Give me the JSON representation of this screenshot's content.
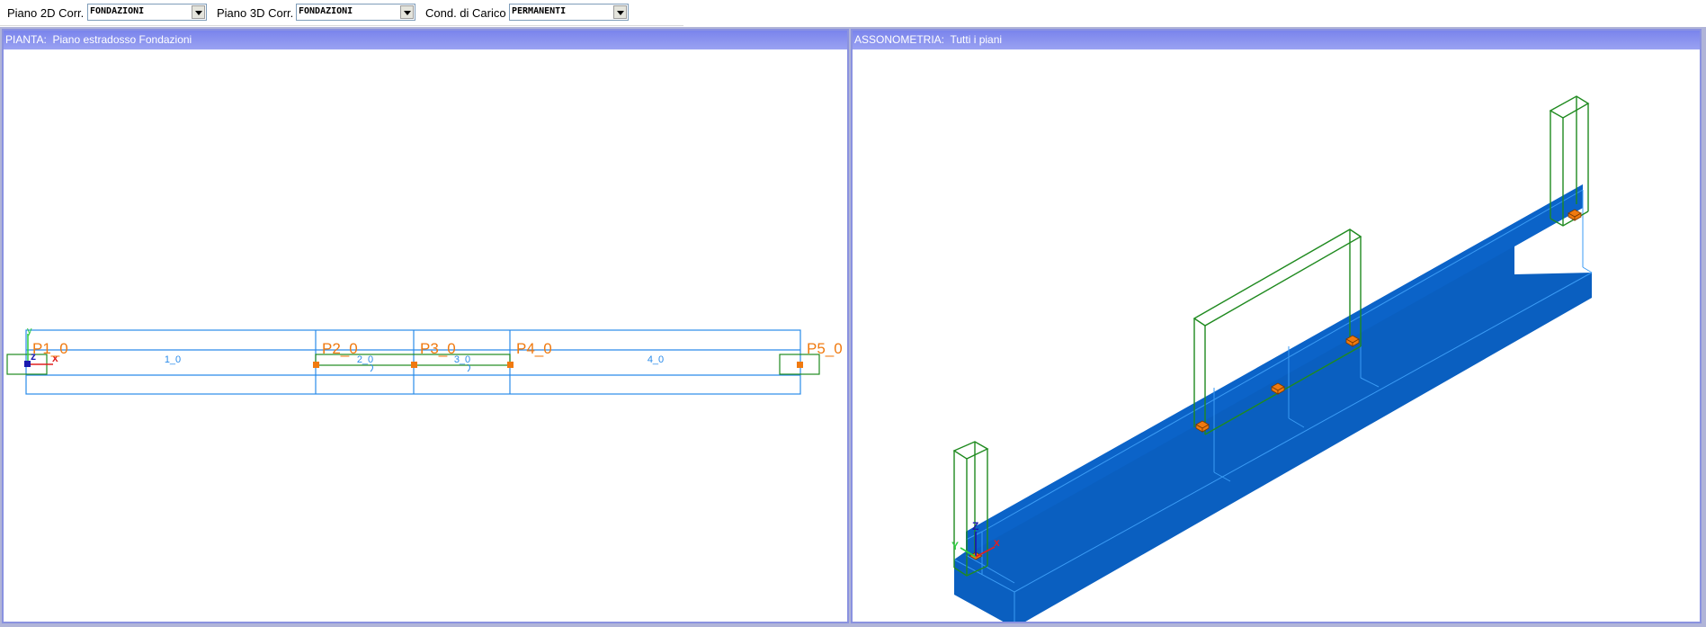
{
  "toolbar": {
    "fields": [
      {
        "label": "Piano 2D Corr.",
        "value": "FONDAZIONI"
      },
      {
        "label": "Piano 3D Corr.",
        "value": "FONDAZIONI"
      },
      {
        "label": "Cond. di Carico",
        "value": "PERMANENTI"
      }
    ]
  },
  "plan_view": {
    "title": "PIANTA:  Piano estradosso Fondazioni",
    "columns": [
      "P1_0",
      "P2_0",
      "P3_0",
      "P4_0",
      "P5_0"
    ],
    "beams": [
      "1_0",
      "2_0",
      "3_0",
      "4_0"
    ],
    "axes": {
      "x": "x",
      "y": "y",
      "z": "z"
    }
  },
  "axo_view": {
    "title": "ASSONOMETRIA:  Tutti i piani",
    "axes": {
      "x": "x",
      "y": "Y",
      "z": "Z"
    }
  },
  "colors": {
    "title_bar": "#7a84ec",
    "foundation_fill": "#0a5fc0",
    "plan_lines": "#2a8bea",
    "column_outline": "#1f8a1f",
    "node_marker": "#f07a10",
    "label_orange": "#f07a10"
  }
}
